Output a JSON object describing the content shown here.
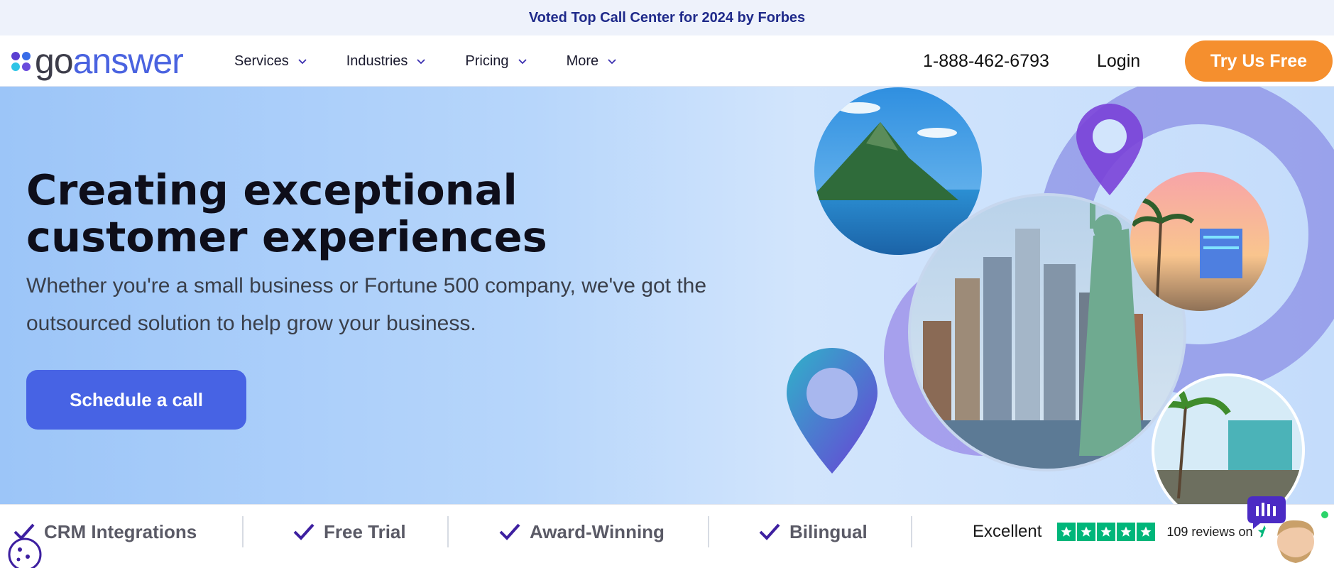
{
  "announcement": "Voted Top Call Center for 2024 by Forbes",
  "logo": {
    "part1": "go",
    "part2": "answer",
    "dot_colors": [
      "#5b3fd1",
      "#3a6de8",
      "#2ec4e6",
      "#6a4bdc"
    ]
  },
  "nav": [
    {
      "label": "Services"
    },
    {
      "label": "Industries"
    },
    {
      "label": "Pricing"
    },
    {
      "label": "More"
    }
  ],
  "header": {
    "phone": "1-888-462-6793",
    "login": "Login",
    "cta": "Try Us Free"
  },
  "hero": {
    "title": "Creating exceptional customer experiences",
    "subtitle": "Whether you're a small business or Fortune 500 company, we've got the outsourced solution to help grow your business.",
    "cta": "Schedule a call"
  },
  "features": [
    {
      "label": "CRM Integrations"
    },
    {
      "label": "Free Trial"
    },
    {
      "label": "Award-Winning"
    },
    {
      "label": "Bilingual"
    }
  ],
  "trustpilot": {
    "rating_text": "Excellent",
    "reviews": "109 reviews on",
    "stars": 5
  },
  "colors": {
    "accent": "#4763e4",
    "orange": "#f58f2e",
    "trust_green": "#00b67a",
    "purple": "#5b3fd1"
  }
}
